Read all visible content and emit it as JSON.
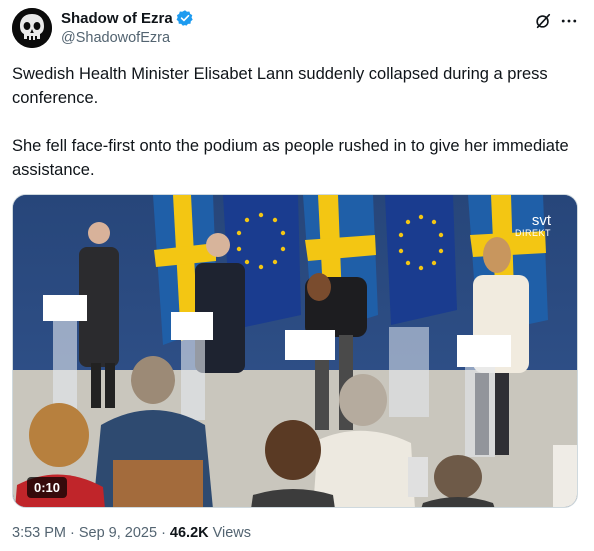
{
  "author": {
    "display_name": "Shadow of Ezra",
    "handle": "@ShadowofEzra",
    "verified": true,
    "avatar_icon": "skull-avatar-icon"
  },
  "post": {
    "paragraphs": [
      "Swedish Health Minister Elisabet Lann suddenly collapsed during a press conference.",
      "She fell face-first onto the podium as people rushed in to give her immediate assistance."
    ]
  },
  "media": {
    "type": "video",
    "duration_badge": "0:10",
    "overlay_logo": "svt",
    "overlay_logo_sub": "DIREKT"
  },
  "meta": {
    "time": "3:53 PM",
    "date": "Sep 9, 2025",
    "views_count": "46.2K",
    "views_label": "Views"
  },
  "colors": {
    "verified": "#1d9bf0",
    "secondary_text": "#536471",
    "primary_text": "#0f1419"
  }
}
